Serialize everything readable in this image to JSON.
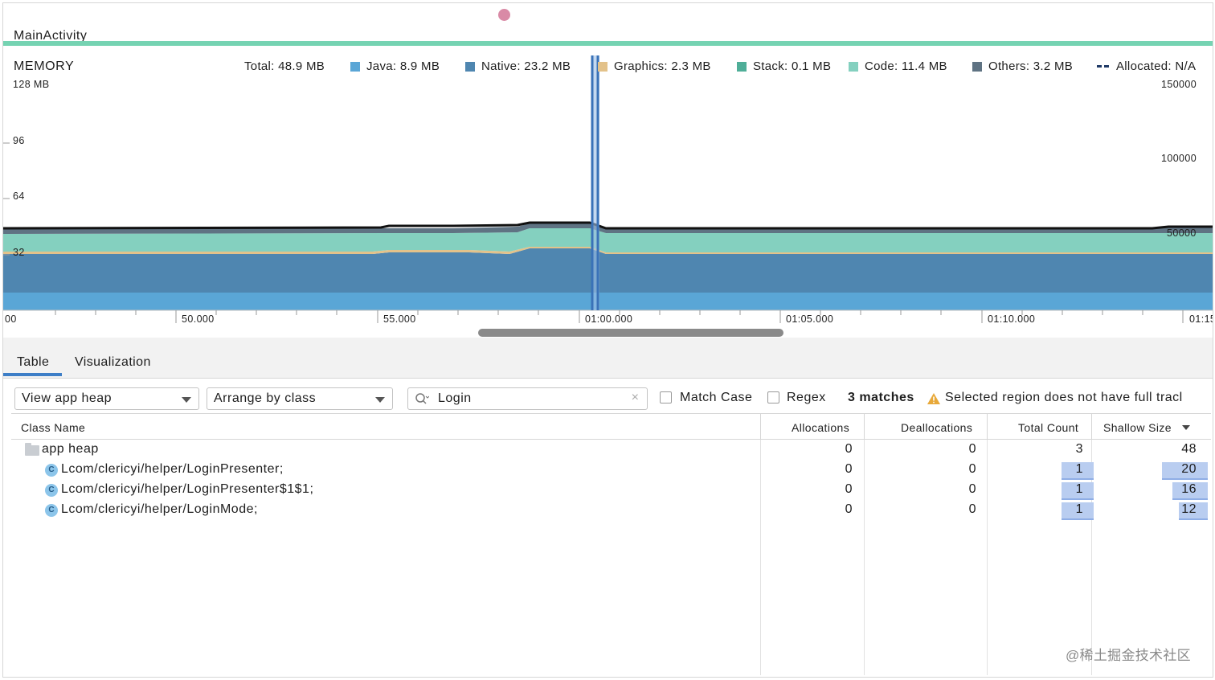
{
  "activity": {
    "label": "MainActivity"
  },
  "memory": {
    "title": "MEMORY",
    "total": "Total: 48.9 MB",
    "legend": [
      {
        "label": "Java: 8.9 MB",
        "color": "#5aa6d6"
      },
      {
        "label": "Native: 23.2 MB",
        "color": "#4f86b0"
      },
      {
        "label": "Graphics: 2.3 MB",
        "color": "#e3c28a"
      },
      {
        "label": "Stack: 0.1 MB",
        "color": "#4fae98"
      },
      {
        "label": "Code: 11.4 MB",
        "color": "#84d0bf"
      },
      {
        "label": "Others: 3.2 MB",
        "color": "#5f7383"
      },
      {
        "label": "Allocated: N/A",
        "color": "#1f3a66"
      }
    ],
    "left_axis": [
      "128 MB",
      "96",
      "64",
      "32"
    ],
    "right_axis": [
      "150000",
      "100000",
      "50000"
    ],
    "time_ticks": [
      "00",
      "50.000",
      "55.000",
      "01:00.000",
      "01:05.000",
      "01:10.000",
      "01:15"
    ]
  },
  "tabs": [
    {
      "label": "Table",
      "active": true
    },
    {
      "label": "Visualization",
      "active": false
    }
  ],
  "toolbar": {
    "heap_select": "View app heap",
    "arrange_select": "Arrange by class",
    "search_value": "Login",
    "match_case_label": "Match Case",
    "regex_label": "Regex",
    "matches": "3 matches",
    "warning": "Selected region does not have full tracl"
  },
  "table": {
    "columns": [
      "Class Name",
      "Allocations",
      "Deallocations",
      "Total Count",
      "Shallow Size"
    ],
    "rows": [
      {
        "name": "app heap",
        "alloc": "0",
        "dealloc": "0",
        "count": "3",
        "size": "48",
        "type": "folder"
      },
      {
        "name": "Lcom/clericyi/helper/LoginPresenter;",
        "alloc": "0",
        "dealloc": "0",
        "count": "1",
        "size": "20",
        "type": "class",
        "icon": "C"
      },
      {
        "name": "Lcom/clericyi/helper/LoginPresenter$1$1;",
        "alloc": "0",
        "dealloc": "0",
        "count": "1",
        "size": "16",
        "type": "class",
        "icon": "C"
      },
      {
        "name": "Lcom/clericyi/helper/LoginMode;",
        "alloc": "0",
        "dealloc": "0",
        "count": "1",
        "size": "12",
        "type": "class",
        "icon": "C"
      }
    ]
  },
  "watermark": "@稀土掘金技术社区"
}
